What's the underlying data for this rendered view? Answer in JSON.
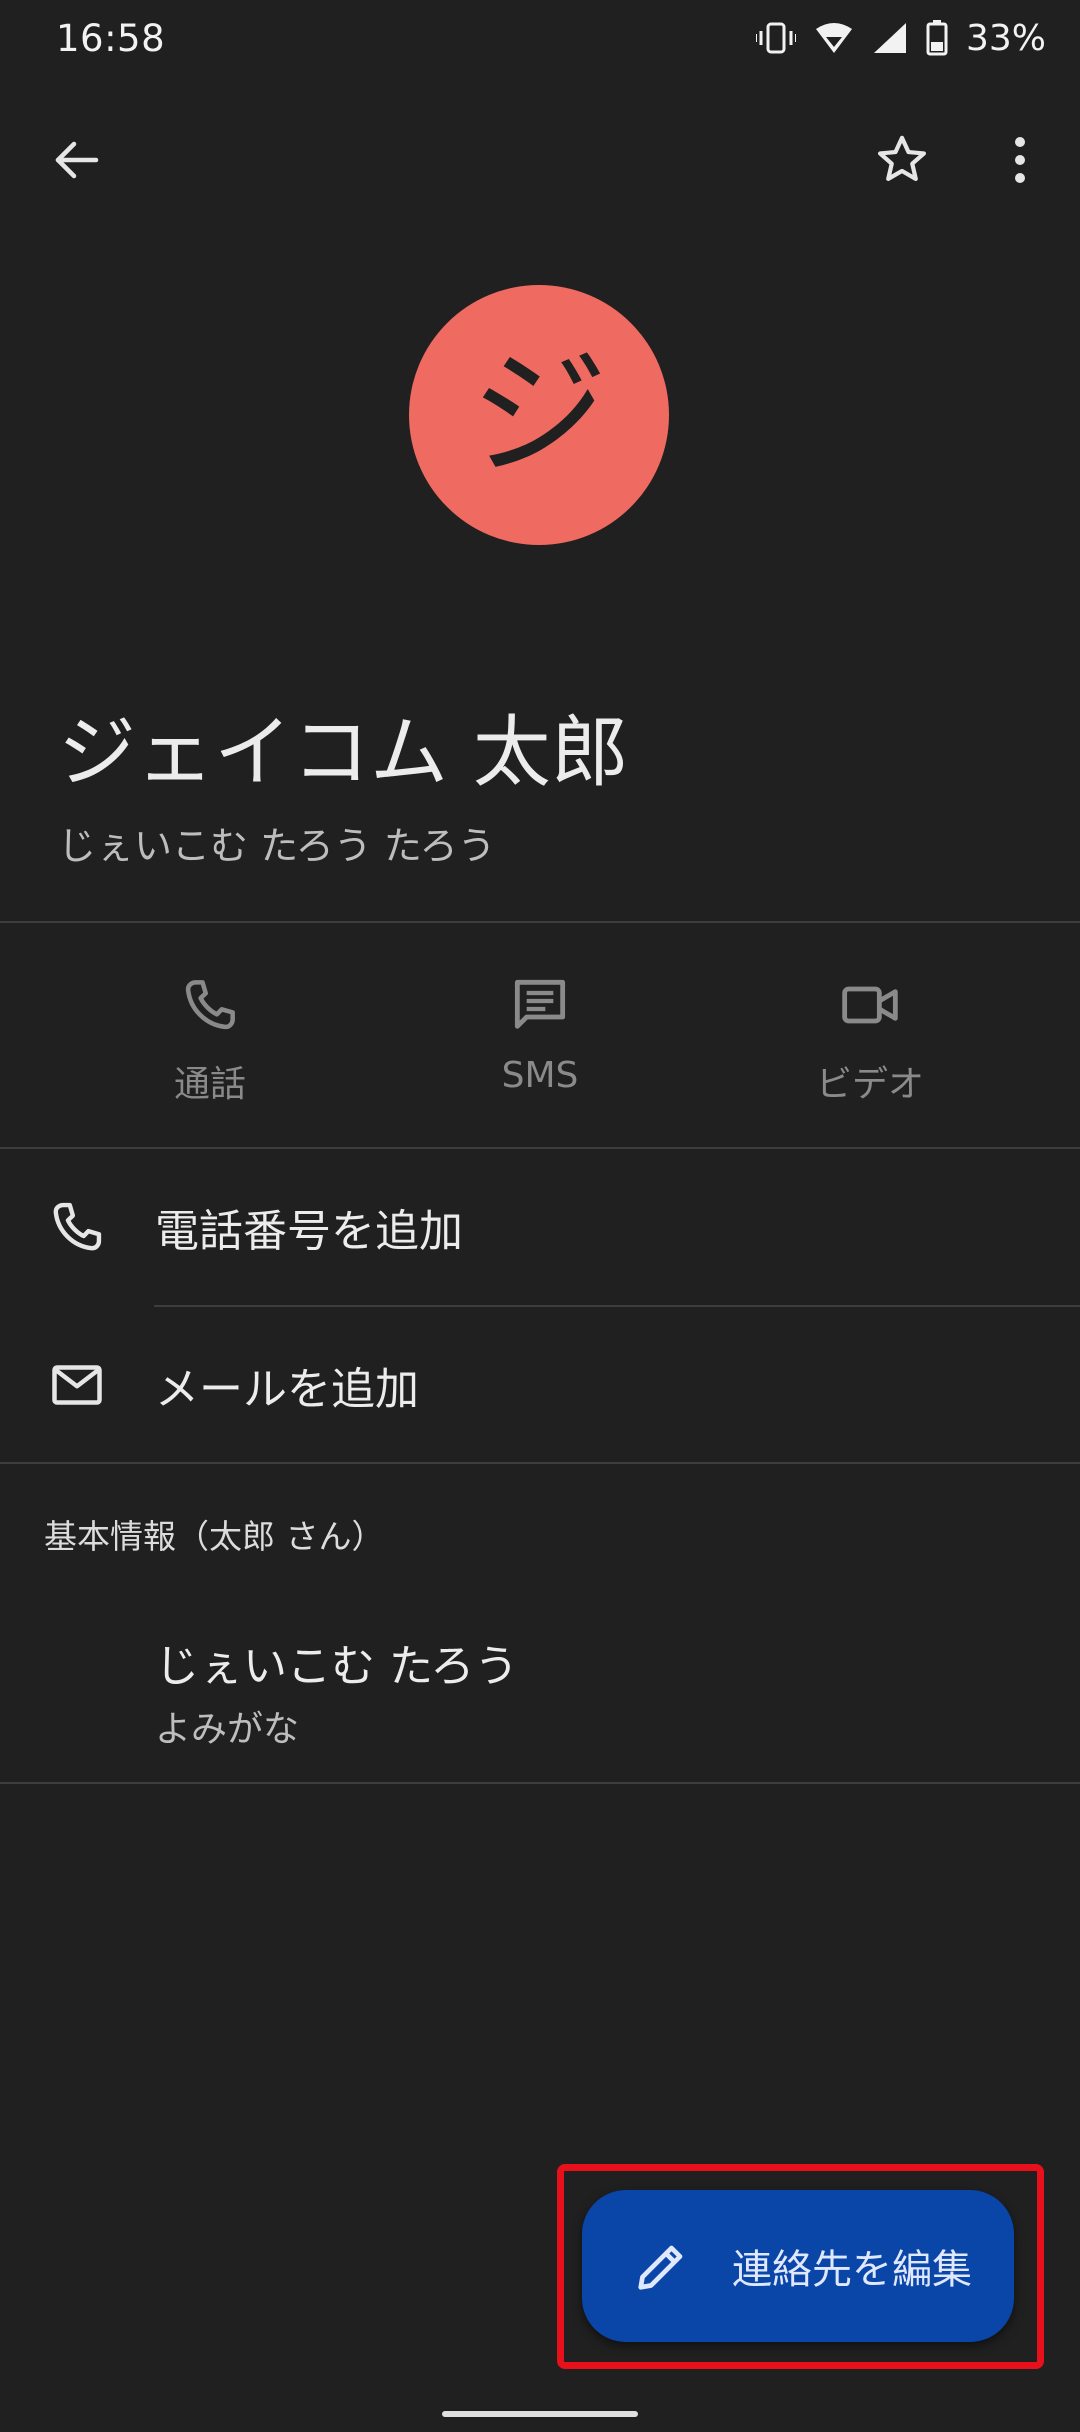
{
  "status_bar": {
    "time": "16:58",
    "battery_percent": "33%",
    "icons": [
      "vibrate-icon",
      "wifi-icon",
      "signal-icon",
      "battery-icon"
    ]
  },
  "app_bar": {
    "icons": [
      "back-arrow-icon",
      "star-outline-icon",
      "more-vert-icon"
    ]
  },
  "avatar": {
    "initial": "ジ",
    "color": "#ef6a60"
  },
  "contact": {
    "name": "ジェイコム 太郎",
    "phonetic": "じぇいこむ たろう たろう"
  },
  "actions": [
    {
      "label": "通話",
      "icon": "phone-icon"
    },
    {
      "label": "SMS",
      "icon": "message-icon"
    },
    {
      "label": "ビデオ",
      "icon": "videocam-icon"
    }
  ],
  "rows": {
    "add_phone": {
      "label": "電話番号を追加",
      "icon": "phone-icon"
    },
    "add_email": {
      "label": "メールを追加",
      "icon": "mail-icon"
    }
  },
  "basic_info": {
    "header": "基本情報（太郎 さん）",
    "value": "じぇいこむ たろう",
    "label": "よみがな"
  },
  "fab": {
    "label": "連絡先を編集",
    "icon": "edit-pencil-icon",
    "color": "#0a45a8",
    "highlight_color": "#e8101a"
  }
}
